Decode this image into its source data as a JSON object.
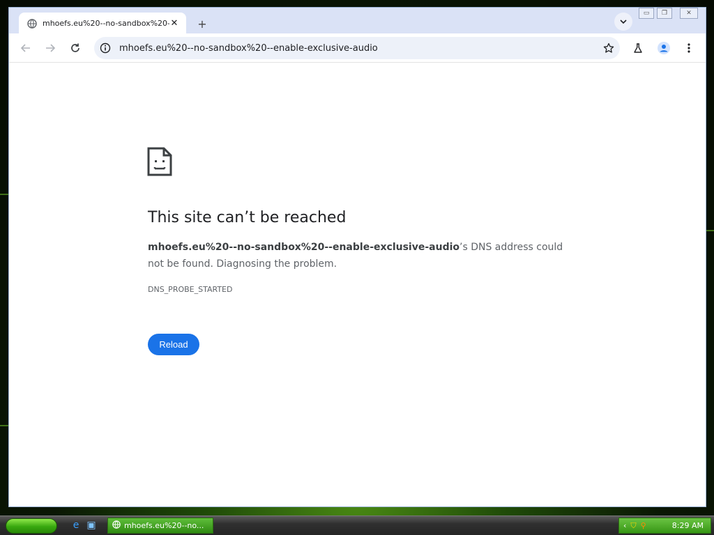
{
  "browser": {
    "tab": {
      "title": "mhoefs.eu%20--no-sandbox%20--",
      "close_symbol": "✕"
    },
    "new_tab_symbol": "+",
    "window_controls": [
      "▭",
      "❐",
      "✕"
    ],
    "address_bar": {
      "url": "mhoefs.eu%20--no-sandbox%20--enable-exclusive-audio"
    }
  },
  "error_page": {
    "title": "This site can’t be reached",
    "host": "mhoefs.eu%20--no-sandbox%20--enable-exclusive-audio",
    "description_suffix": "’s DNS address could not be found. Diagnosing the problem.",
    "error_code": "DNS_PROBE_STARTED",
    "reload_label": "Reload"
  },
  "taskbar": {
    "task_item_label": "mhoefs.eu%20--no...",
    "clock": "8:29 AM"
  },
  "colors": {
    "accent": "#1a73e8",
    "titlebar": "#dae2f6",
    "omnibox": "#edf1f9",
    "taskbar_green": "#379615"
  },
  "icons": [
    "globe-icon",
    "tab-close-icon",
    "new-tab-icon",
    "tab-search-icon",
    "back-icon",
    "forward-icon",
    "reload-icon",
    "site-info-icon",
    "bookmark-star-icon",
    "labs-flask-icon",
    "profile-icon",
    "menu-dots-icon",
    "sad-page-icon"
  ]
}
